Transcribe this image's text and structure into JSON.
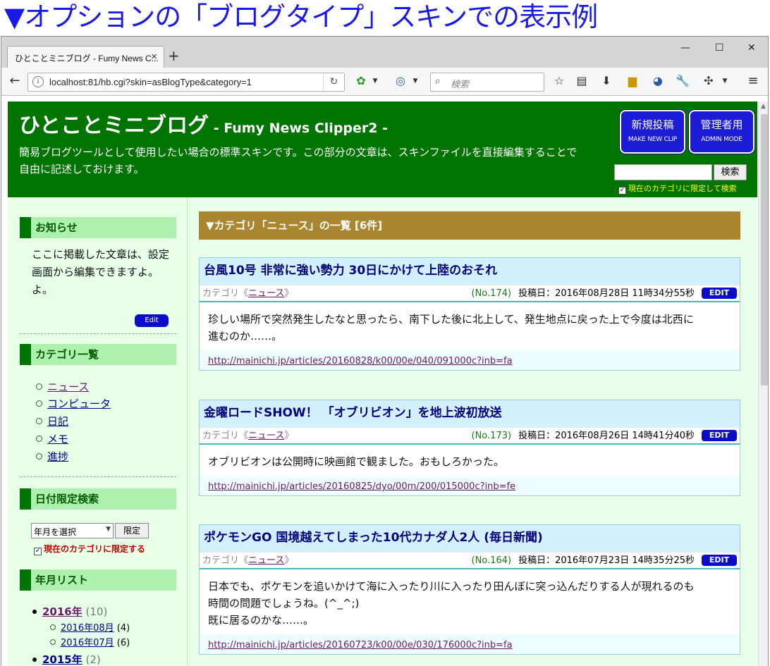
{
  "caption": "▼オプションの「ブログタイプ」スキンでの表示例",
  "browser": {
    "tab_title": "ひとことミニブログ - Fumy News C...",
    "tab_close": "×",
    "new_tab": "+",
    "url": "localhost:81/hb.cgi?skin=asBlogType&category=1",
    "search_placeholder": "検索",
    "controls": {
      "minimize": "—",
      "maximize": "☐",
      "close": "✕"
    }
  },
  "header": {
    "title": "ひとことミニブログ",
    "subtitle": " - Fumy News Clipper2 -",
    "description": "簡易ブログツールとして使用したい場合の標準スキンです。この部分の文章は、スキンファイルを直接編集することで自由に記述しておけます。",
    "new_post_main": "新規投稿",
    "new_post_sub": "MAKE NEW CLIP",
    "admin_main": "管理者用",
    "admin_sub": "ADMIN MODE",
    "search_button": "検索",
    "search_limit_label": "現在のカテゴリに限定して検索"
  },
  "sidebar": {
    "notice_head": "お知らせ",
    "notice_text": "ここに掲載した文章は、設定画面から編集できますよ。よ。",
    "notice_edit": "Edit",
    "category_head": "カテゴリ一覧",
    "categories": [
      "ニュース",
      "コンピュータ",
      "日記",
      "メモ",
      "進捗"
    ],
    "date_head": "日付限定検索",
    "month_select": "年月を選択",
    "limit_button": "限定",
    "limit_check": "現在のカテゴリに限定する",
    "yearlist_head": "年月リスト",
    "years": [
      {
        "label": "2016年",
        "count": "(10)",
        "months": [
          {
            "label": "2016年08月",
            "count": "(4)"
          },
          {
            "label": "2016年07月",
            "count": "(6)"
          }
        ]
      },
      {
        "label": "2015年",
        "count": "(2)"
      }
    ]
  },
  "main": {
    "category_header": "▼カテゴリ「ニュース」の一覧 [6件]",
    "posts": [
      {
        "title": "台風10号 非常に強い勢力 30日にかけて上陸のおそれ",
        "category_prefix": "カテゴリ《",
        "category": "ニュース",
        "category_suffix": "》",
        "number": "(No.174)",
        "date": "投稿日：2016年08月28日 11時34分55秒",
        "edit": "EDIT",
        "body": [
          "珍しい場所で突然発生したなと思ったら、南下した後に北上して、発生地点に戻った上で今度は北西に",
          "進むのか……。"
        ],
        "link": "http://mainichi.jp/articles/20160828/k00/00e/040/091000c?inb=fa"
      },
      {
        "title": "金曜ロードSHOW！ 「オブリビオン」を地上波初放送",
        "category_prefix": "カテゴリ《",
        "category": "ニュース",
        "category_suffix": "》",
        "number": "(No.173)",
        "date": "投稿日：2016年08月26日 14時41分40秒",
        "edit": "EDIT",
        "body": [
          "オブリビオンは公開時に映画館で観ました。おもしろかった。"
        ],
        "link": "http://mainichi.jp/articles/20160825/dyo/00m/200/015000c?inb=fe"
      },
      {
        "title": "ポケモンGO 国境越えてしまった10代カナダ人2人 (毎日新聞)",
        "category_prefix": "カテゴリ《",
        "category": "ニュース",
        "category_suffix": "》",
        "number": "(No.164)",
        "date": "投稿日：2016年07月23日 14時35分25秒",
        "edit": "EDIT",
        "body": [
          "日本でも、ポケモンを追いかけて海に入ったり川に入ったり田んぼに突っ込んだりする人が現れるのも",
          "時間の問題でしょうね。(^_^;)",
          "既に居るのかな……。"
        ],
        "link": "http://mainichi.jp/articles/20160723/k00/00e/030/176000c?inb=fa"
      }
    ]
  }
}
